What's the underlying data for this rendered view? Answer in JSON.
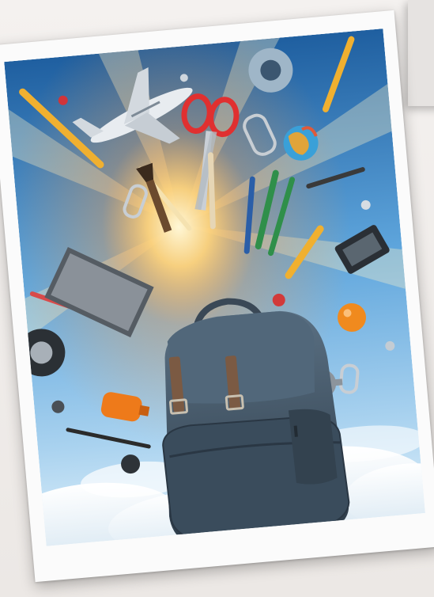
{
  "scene": {
    "subject": "backpack-icon",
    "palette": {
      "sky_top": "#2b6fb2",
      "sky_mid": "#5ea5dc",
      "horizon": "#cfe6f6",
      "cloud": "#ffffff",
      "burst": "#ffd27a",
      "backpack": "#3c4d5e",
      "backpack_light": "#536879",
      "strap": "#7b5a43",
      "scissors": "#e03030",
      "pencil": "#f0b030",
      "pen_green": "#2f8f4a",
      "pen_blue": "#2a5ea8",
      "airplane": "#e8ecf0"
    },
    "objects": [
      "airplane-icon",
      "scissors-icon",
      "pencil-icon",
      "paperclip-icon",
      "globe-icon",
      "tape-icon",
      "gear-icon",
      "ruler-icon",
      "brush-icon",
      "orange-ball-icon",
      "cloud-icon"
    ]
  }
}
